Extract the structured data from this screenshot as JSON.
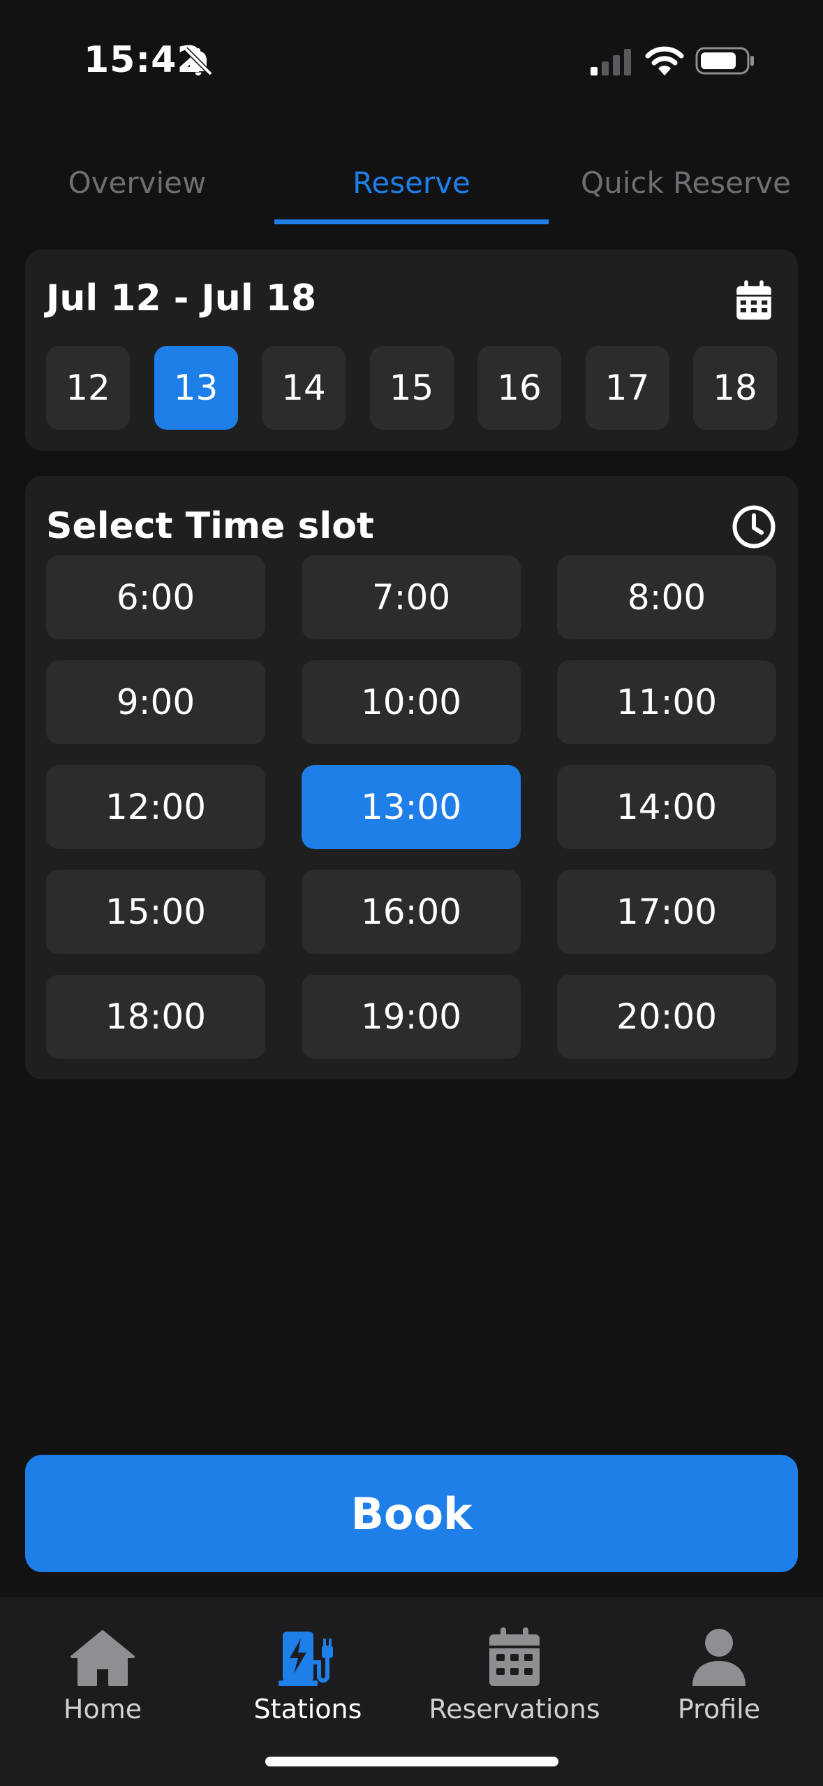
{
  "status_bar": {
    "time": "15:42",
    "icons": [
      "bell-slash-icon",
      "signal-icon",
      "wifi-icon",
      "battery-icon"
    ]
  },
  "tabs": [
    {
      "label": "Overview",
      "active": false
    },
    {
      "label": "Reserve",
      "active": true
    },
    {
      "label": "Quick Reserve",
      "active": false
    }
  ],
  "date_card": {
    "title": "Jul 12 - Jul 18",
    "icon": "calendar-icon",
    "days": [
      "12",
      "13",
      "14",
      "15",
      "16",
      "17",
      "18"
    ],
    "selected_day": "13"
  },
  "time_card": {
    "title": "Select Time slot",
    "icon": "clock-icon",
    "slots": [
      "6:00",
      "7:00",
      "8:00",
      "9:00",
      "10:00",
      "11:00",
      "12:00",
      "13:00",
      "14:00",
      "15:00",
      "16:00",
      "17:00",
      "18:00",
      "19:00",
      "20:00"
    ],
    "selected_slot": "13:00"
  },
  "book_button": {
    "label": "Book"
  },
  "bottom_nav": [
    {
      "label": "Home",
      "icon": "home-icon",
      "active": false
    },
    {
      "label": "Stations",
      "icon": "ev-station-icon",
      "active": true
    },
    {
      "label": "Reservations",
      "icon": "calendar-icon",
      "active": false
    },
    {
      "label": "Profile",
      "icon": "person-icon",
      "active": false
    }
  ],
  "colors": {
    "accent": "#1e7fe8",
    "background": "#121212",
    "card": "#1f1f1f",
    "button": "#2c2c2e",
    "inactive_tab": "#6e6e73",
    "nav_icon": "#8e8e93"
  }
}
